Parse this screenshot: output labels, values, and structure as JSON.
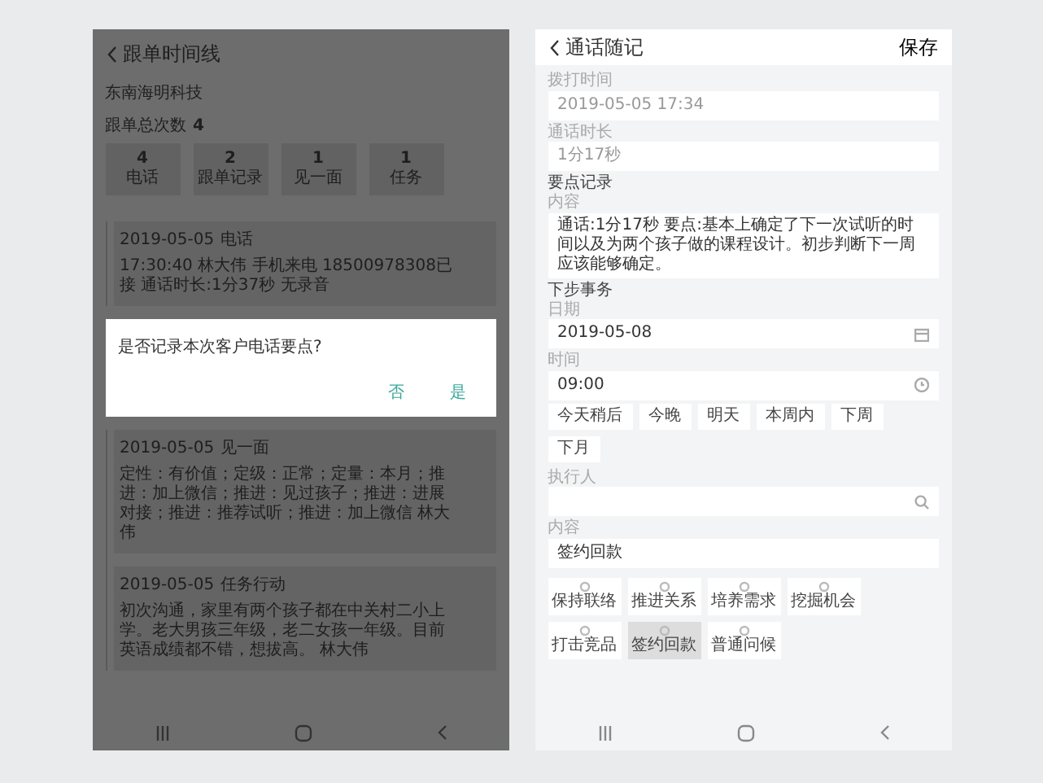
{
  "left_screen": {
    "title": "跟单时间线",
    "company": "东南海明科技",
    "count_label": "跟单总次数",
    "count": "4",
    "stats": [
      {
        "value": "4",
        "label": "电话"
      },
      {
        "value": "2",
        "label": "跟单记录"
      },
      {
        "value": "1",
        "label": "见一面"
      },
      {
        "value": "1",
        "label": "任务"
      }
    ],
    "timeline": [
      {
        "date": "2019-05-05",
        "type": "电话",
        "text": "17:30:40 林大伟 手机来电 18500978308已接 通话时长:1分37秒 无录音"
      },
      {
        "date": "2019-05-05",
        "type": "见一面",
        "text": "定性：有价值；定级：正常；定量：本月；推进：加上微信；推进：见过孩子；推进：进展对接；推进：推荐试听；推进：加上微信 林大伟"
      },
      {
        "date": "2019-05-05",
        "type": "任务行动",
        "text": "初次沟通，家里有两个孩子都在中关村二小上学。老大男孩三年级，老二女孩一年级。目前英语成绩都不错，想拔高。 林大伟"
      }
    ],
    "dialog": {
      "message": "是否记录本次客户电话要点?",
      "buttons": [
        "否",
        "是"
      ]
    }
  },
  "right_screen": {
    "title": "通话随记",
    "save": "保存",
    "items": [
      {
        "kind": "readonly",
        "label": "拨打时间",
        "value": "2019-05-05 17:34"
      },
      {
        "kind": "readonly",
        "label": "通话时长",
        "value": "1分17秒"
      },
      {
        "kind": "section",
        "label": "要点记录"
      },
      {
        "kind": "text",
        "label": "内容",
        "value": "通话:1分17秒  要点:基本上确定了下一次试听的时间以及为两个孩子做的课程设计。初步判断下一周应该能够确定。"
      },
      {
        "kind": "section",
        "label": "下步事务"
      },
      {
        "kind": "date",
        "label": "日期",
        "value": "2019-05-08"
      },
      {
        "kind": "time",
        "label": "时间",
        "value": "09:00"
      },
      {
        "kind": "chips",
        "options": [
          "今天稍后",
          "今晚",
          "明天",
          "本周内",
          "下周",
          "下月"
        ]
      },
      {
        "kind": "search",
        "label": "执行人"
      },
      {
        "kind": "field",
        "label": "内容",
        "value": "签约回款"
      },
      {
        "kind": "tiles",
        "options": [
          {
            "label": "保持联络",
            "selected": false
          },
          {
            "label": "推进关系",
            "selected": false
          },
          {
            "label": "培养需求",
            "selected": false
          },
          {
            "label": "挖掘机会",
            "selected": false
          },
          {
            "label": "打击竞品",
            "selected": false
          },
          {
            "label": "签约回款",
            "selected": true
          },
          {
            "label": "普通问候",
            "selected": false
          }
        ]
      }
    ]
  }
}
